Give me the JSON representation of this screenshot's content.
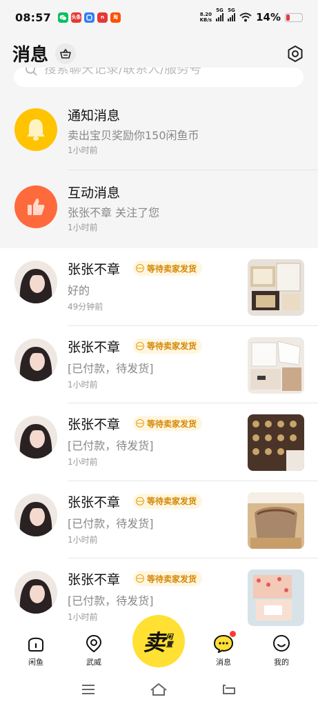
{
  "status_bar": {
    "time": "08:57",
    "net_speed_value": "8.20",
    "net_speed_unit": "KB/s",
    "signal_1_tag": "5G",
    "signal_2_tag": "5G",
    "battery_percent": "14%",
    "apps": [
      {
        "name": "wechat",
        "color": "#07c160",
        "text": ""
      },
      {
        "name": "toutiao",
        "color": "#e53935",
        "text": "头条"
      },
      {
        "name": "blue-app",
        "color": "#2f7ff5",
        "text": ""
      },
      {
        "name": "pdd",
        "color": "#e53935",
        "text": "n"
      },
      {
        "name": "taobao",
        "color": "#ff5000",
        "text": "淘"
      }
    ]
  },
  "header": {
    "title": "消息"
  },
  "search": {
    "placeholder": "搜索聊天记录/联系人/服务号"
  },
  "system_rows": [
    {
      "title": "通知消息",
      "subtitle": "卖出宝贝奖励你150闲鱼币",
      "time": "1小时前",
      "icon": "bell-icon",
      "color": "#ffc300"
    },
    {
      "title": "互动消息",
      "subtitle": "张张不章 关注了您",
      "time": "1小时前",
      "icon": "thumbs-up-icon",
      "color": "#ff6a3d"
    }
  ],
  "conversations": [
    {
      "name": "张张不章",
      "badge": "等待卖家发货",
      "message": "好的",
      "time": "49分钟前",
      "thumb_theme": "coach-box"
    },
    {
      "name": "张张不章",
      "badge": "等待卖家发货",
      "message": "[已付款，待发货]",
      "time": "1小时前",
      "thumb_theme": "chanel-scarf"
    },
    {
      "name": "张张不章",
      "badge": "等待卖家发货",
      "message": "[已付款，待发货]",
      "time": "1小时前",
      "thumb_theme": "gucci-scarf"
    },
    {
      "name": "张张不章",
      "badge": "等待卖家发货",
      "message": "[已付款，待发货]",
      "time": "1小时前",
      "thumb_theme": "coach-bag"
    },
    {
      "name": "张张不章",
      "badge": "等待卖家发货",
      "message": "[已付款，待发货]",
      "time": "1小时前",
      "thumb_theme": "gift-box"
    }
  ],
  "bottom_nav": {
    "items": [
      {
        "label": "闲鱼",
        "icon": "home-icon"
      },
      {
        "label": "武威",
        "icon": "location-icon"
      },
      {
        "label": "消息",
        "icon": "message-icon",
        "has_dot": true
      },
      {
        "label": "我的",
        "icon": "profile-icon"
      }
    ],
    "sell_main": "卖",
    "sell_sub": "闲置"
  },
  "colors": {
    "accent_yellow": "#ffe033",
    "badge_text": "#d48806",
    "badge_bg": "#fff6e0",
    "notify_yellow": "#ffc300",
    "interact_orange": "#ff6a3d"
  }
}
